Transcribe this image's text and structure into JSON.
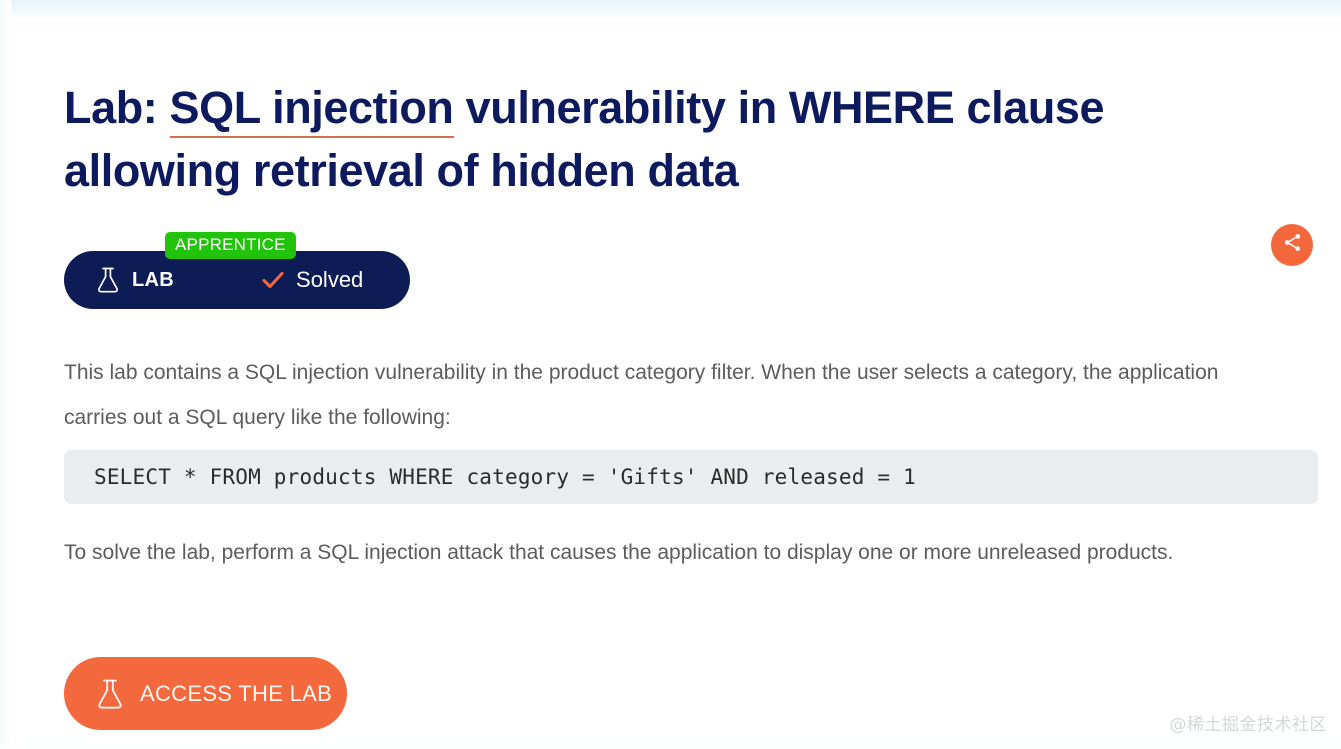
{
  "page": {
    "background_color": "#ffffff",
    "accent_orange": "#f4683e",
    "navy": "#0e1a5e",
    "green": "#21c40b"
  },
  "title": {
    "prefix": "Lab: ",
    "underlined": "SQL injection",
    "suffix": " vulnerability in WHERE clause allowing retrieval of hidden data",
    "full": "Lab: SQL injection vulnerability in WHERE clause allowing retrieval of hidden data"
  },
  "lab_widget": {
    "level_tag": "APPRENTICE",
    "lab_label": "LAB",
    "status_label": "Solved",
    "flask_icon": "flask-icon",
    "check_icon": "check-icon",
    "pill_color": "#0d1c55",
    "tag_color": "#21c40b",
    "check_color": "#f4663c"
  },
  "share": {
    "icon": "share-icon",
    "color": "#f4663c"
  },
  "body": {
    "paragraph_1": "This lab contains a SQL injection vulnerability in the product category filter. When the user selects a category, the application carries out a SQL query like the following:",
    "paragraph_2": "To solve the lab, perform a SQL injection attack that causes the application to display one or more unreleased products."
  },
  "code": {
    "query": "SELECT * FROM products WHERE category = 'Gifts' AND released = 1",
    "background_color": "#e9edef"
  },
  "access_button": {
    "label": "ACCESS THE LAB",
    "icon": "flask-icon",
    "color": "#f4683e"
  },
  "watermark": {
    "text": "@稀土掘金技术社区"
  }
}
